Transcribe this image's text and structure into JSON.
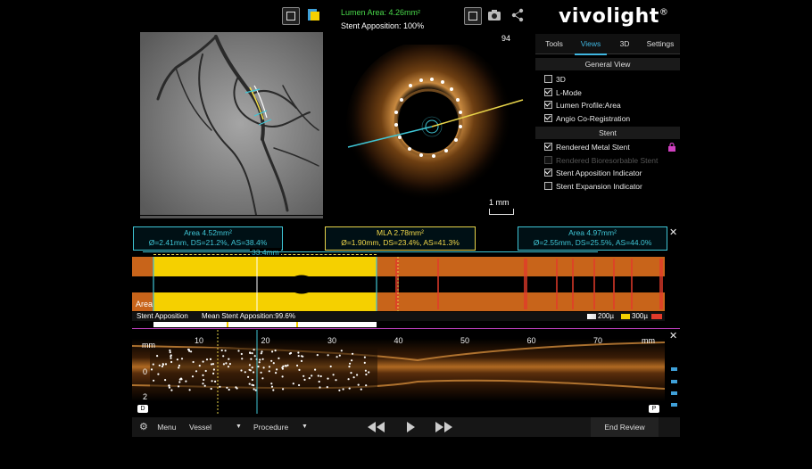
{
  "brand": {
    "logo": "vivolight",
    "reg": "®"
  },
  "oct": {
    "lumen_area": "Lumen Area: 4.26mm²",
    "stent_apposition": "Stent Apposition: 100%",
    "frame": "94",
    "scale": "1 mm"
  },
  "tabs": [
    "Tools",
    "Views",
    "3D",
    "Settings"
  ],
  "active_tab": "Views",
  "general_view": {
    "header": "General View",
    "items": [
      {
        "label": "3D",
        "checked": false
      },
      {
        "label": "L-Mode",
        "checked": true
      },
      {
        "label": "Lumen Profile:Area",
        "checked": true
      },
      {
        "label": "Angio Co-Registration",
        "checked": true
      }
    ]
  },
  "stent": {
    "header": "Stent",
    "items": [
      {
        "label": "Rendered Metal Stent",
        "checked": true,
        "disabled": false
      },
      {
        "label": "Rendered Bioresorbable Stent",
        "checked": false,
        "disabled": true
      },
      {
        "label": "Stent Apposition Indicator",
        "checked": true,
        "disabled": false
      },
      {
        "label": "Stent Expansion Indicator",
        "checked": false,
        "disabled": false
      }
    ]
  },
  "measurements": {
    "left": {
      "area": "Area 4.52mm²",
      "detail": "Ø=2.41mm, DS=21.2%, AS=38.4%"
    },
    "mla": {
      "area": "MLA 2.78mm²",
      "detail": "Ø=1.90mm, DS=23.4%, AS=41.3%"
    },
    "right": {
      "area": "Area 4.97mm²",
      "detail": "Ø=2.55mm, DS=25.5%, AS=44.0%"
    },
    "length": "33.4mm"
  },
  "lumen_profile": {
    "label": "Area"
  },
  "apposition_bar": {
    "label": "Stent Apposition",
    "mean": "Mean Stent Apposition:99.6%",
    "legend_200": "200µ",
    "legend_300": "300µ"
  },
  "lmode": {
    "axis_unit": "mm",
    "x_ticks": [
      "10",
      "20",
      "30",
      "40",
      "50",
      "60",
      "70"
    ],
    "y_ticks": [
      "0",
      "2"
    ],
    "left_marker": "D",
    "right_marker": "P"
  },
  "bottombar": {
    "menu": "Menu",
    "vessel": "Vessel",
    "procedure": "Procedure",
    "end_review": "End Review"
  },
  "colors": {
    "accent": "#3fb6e0",
    "stent_yellow": "#f5d000",
    "lumen_orange": "#c8641a",
    "malapposition_red": "#e23a2a",
    "cyan": "#3fc6d6"
  }
}
